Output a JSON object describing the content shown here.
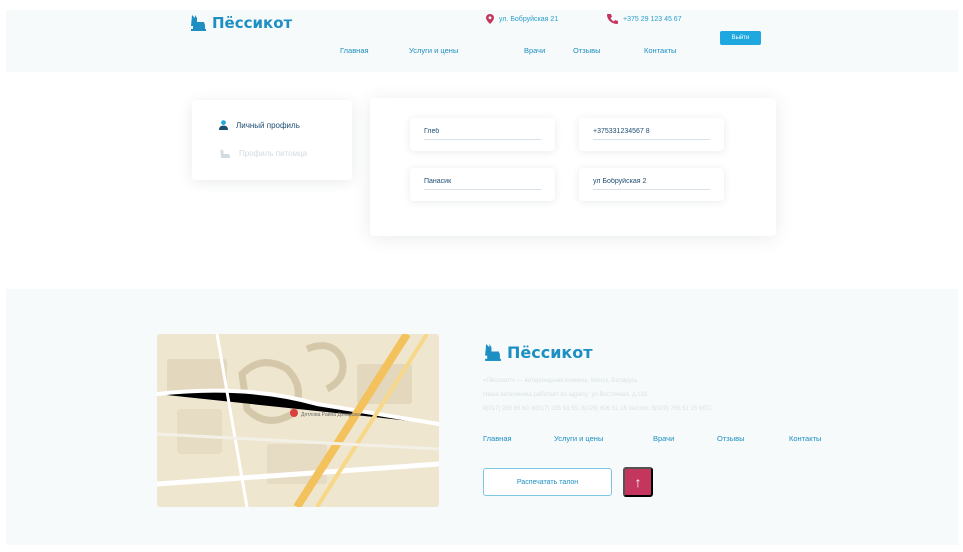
{
  "brand": {
    "name": "Пёссикот",
    "color": "#1d8fc2"
  },
  "header": {
    "address": "ул. Бобруйская 21",
    "phone": "+375 29 123 45 67",
    "logout_label": "Выйти",
    "nav": [
      "Главная",
      "Услуги и цены",
      "Врачи",
      "Отзывы",
      "Контакты"
    ]
  },
  "sidebar": {
    "items": [
      {
        "label": "Личный профиль",
        "icon": "user-icon",
        "active": true
      },
      {
        "label": "Профиль питомца",
        "icon": "pet-icon",
        "active": false
      }
    ]
  },
  "profile_form": {
    "first_name": "Глеб",
    "phone": "+375331234567 8",
    "last_name": "Панасик",
    "address": "ул Бобруйская 2"
  },
  "footer": {
    "description": "«Пёссикот» — ветеринарная клиника, Минск, Беларусь",
    "address_line": "Наша ветклиника работает по адресу: ул.Восточная, д.133",
    "phones": "8(017) 285 65 60, 8(017) 285 93 55, 8(029) 606 51 15 Velcom, 8(029) 765 51 15 МТС",
    "map_pin_label": "Дятлова Райна Дзяарова",
    "nav": [
      "Главная",
      "Услуги и цены",
      "Врачи",
      "Отзывы",
      "Контакты"
    ],
    "print_label": "Распечатать талон",
    "up_icon": "↑",
    "accent": "#c4365e"
  }
}
